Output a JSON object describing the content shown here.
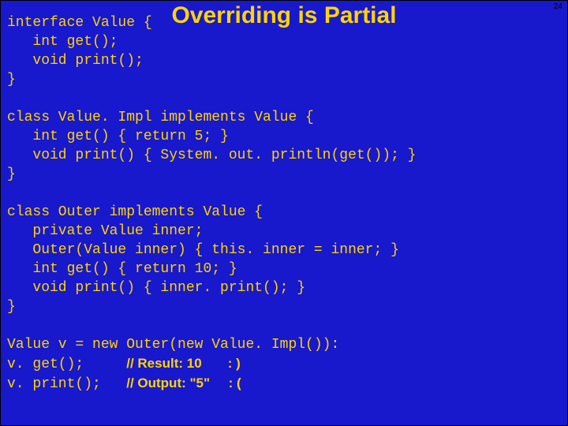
{
  "slide": {
    "title": "Overriding is Partial",
    "page_number": "24"
  },
  "code": {
    "l1": "interface Value {",
    "l2": "   int get();",
    "l3": "   void print();",
    "l4": "}",
    "l5": "",
    "l6": "class Value. Impl implements Value {",
    "l7": "   int get() { return 5; }",
    "l8": "   void print() { System. out. println(get()); }",
    "l9": "}",
    "l10": "",
    "l11": "class Outer implements Value {",
    "l12": "   private Value inner;",
    "l13": "   Outer(Value inner) { this. inner = inner; }",
    "l14": "   int get() { return 10; }",
    "l15": "   void print() { inner. print(); }",
    "l16": "}",
    "l17": "",
    "l18": "Value v = new Outer(new Value. Impl()):",
    "l19a": "v. get();     ",
    "l19b": "// Result: 10       : )",
    "l20a": "v. print();   ",
    "l20b": "// Output: \"5\"     : ("
  }
}
